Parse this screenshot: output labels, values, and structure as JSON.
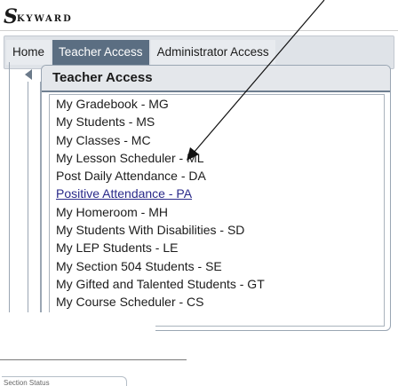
{
  "logo": {
    "mark": "S",
    "text": "KYWARD"
  },
  "nav": {
    "items": [
      {
        "label": "Home",
        "active": false
      },
      {
        "label": "Teacher Access",
        "active": true
      },
      {
        "label": "Administrator Access",
        "active": false
      }
    ]
  },
  "panel": {
    "title": "Teacher Access",
    "items": [
      {
        "label": "My Gradebook - MG",
        "link": false
      },
      {
        "label": "My Students - MS",
        "link": false
      },
      {
        "label": "My Classes - MC",
        "link": false
      },
      {
        "label": "My Lesson Scheduler - ML",
        "link": false
      },
      {
        "label": "Post Daily Attendance - DA",
        "link": false
      },
      {
        "label": "Positive Attendance - PA",
        "link": true
      },
      {
        "label": "My Homeroom - MH",
        "link": false
      },
      {
        "label": "My Students With Disabilities - SD",
        "link": false
      },
      {
        "label": "My LEP Students - LE",
        "link": false
      },
      {
        "label": "My Section 504 Students - SE",
        "link": false
      },
      {
        "label": "My Gifted and Talented Students - GT",
        "link": false
      },
      {
        "label": "My Course Scheduler - CS",
        "link": false
      }
    ]
  },
  "status_fragment": "Section Status"
}
